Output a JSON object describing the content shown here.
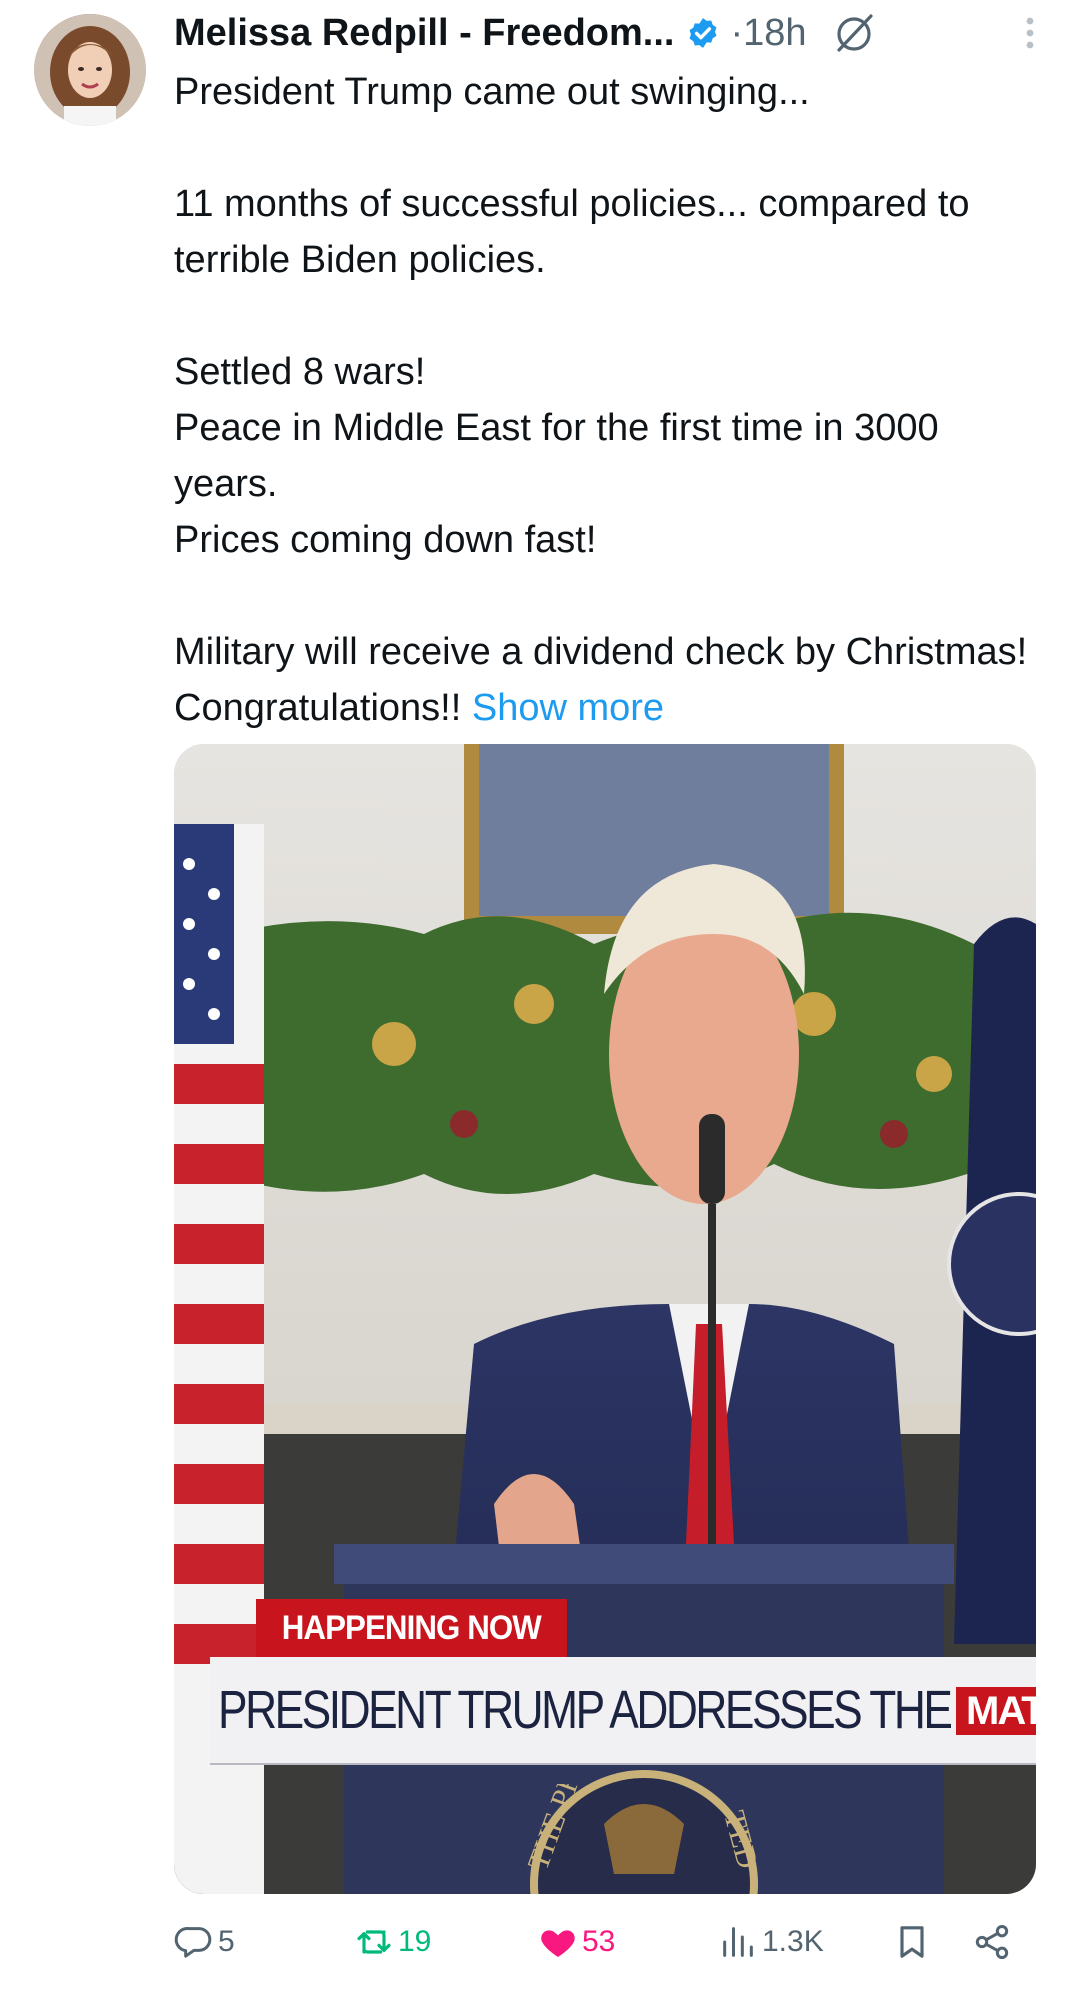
{
  "author": {
    "display_name": "Melissa Redpill - Freedom...",
    "verified": true,
    "dot_time": "·18h"
  },
  "tweet": {
    "lines": [
      "President Trump came out swinging...",
      "",
      "11 months of successful policies... compared to terrible Biden policies.",
      "",
      "Settled 8 wars!",
      "Peace in Middle East for the first time in 3000 years.",
      "Prices coming down fast!",
      "",
      "Military will receive a dividend check by Christmas! Congratulations!!"
    ],
    "show_more": "Show more"
  },
  "media": {
    "chyron_tag": "HAPPENING NOW",
    "chyron_headline": "PRESIDENT TRUMP ADDRESSES THE NATION",
    "chyron_name": "MATT",
    "seal_text_left": "THE PR",
    "seal_text_right": "TED"
  },
  "actions": {
    "replies": "5",
    "reposts": "19",
    "likes": "53",
    "views": "1.3K"
  },
  "colors": {
    "accent": "#1d9bf0",
    "repost": "#00ba7c",
    "like": "#f91880",
    "muted": "#536471",
    "text": "#0f1419"
  },
  "icons": {
    "verified": "verified-badge-icon",
    "grok": "grok-icon",
    "more": "more-vertical-icon",
    "reply": "reply-icon",
    "repost": "repost-icon",
    "like": "heart-filled-icon",
    "views": "views-bar-icon",
    "bookmark": "bookmark-icon",
    "share": "share-icon"
  }
}
